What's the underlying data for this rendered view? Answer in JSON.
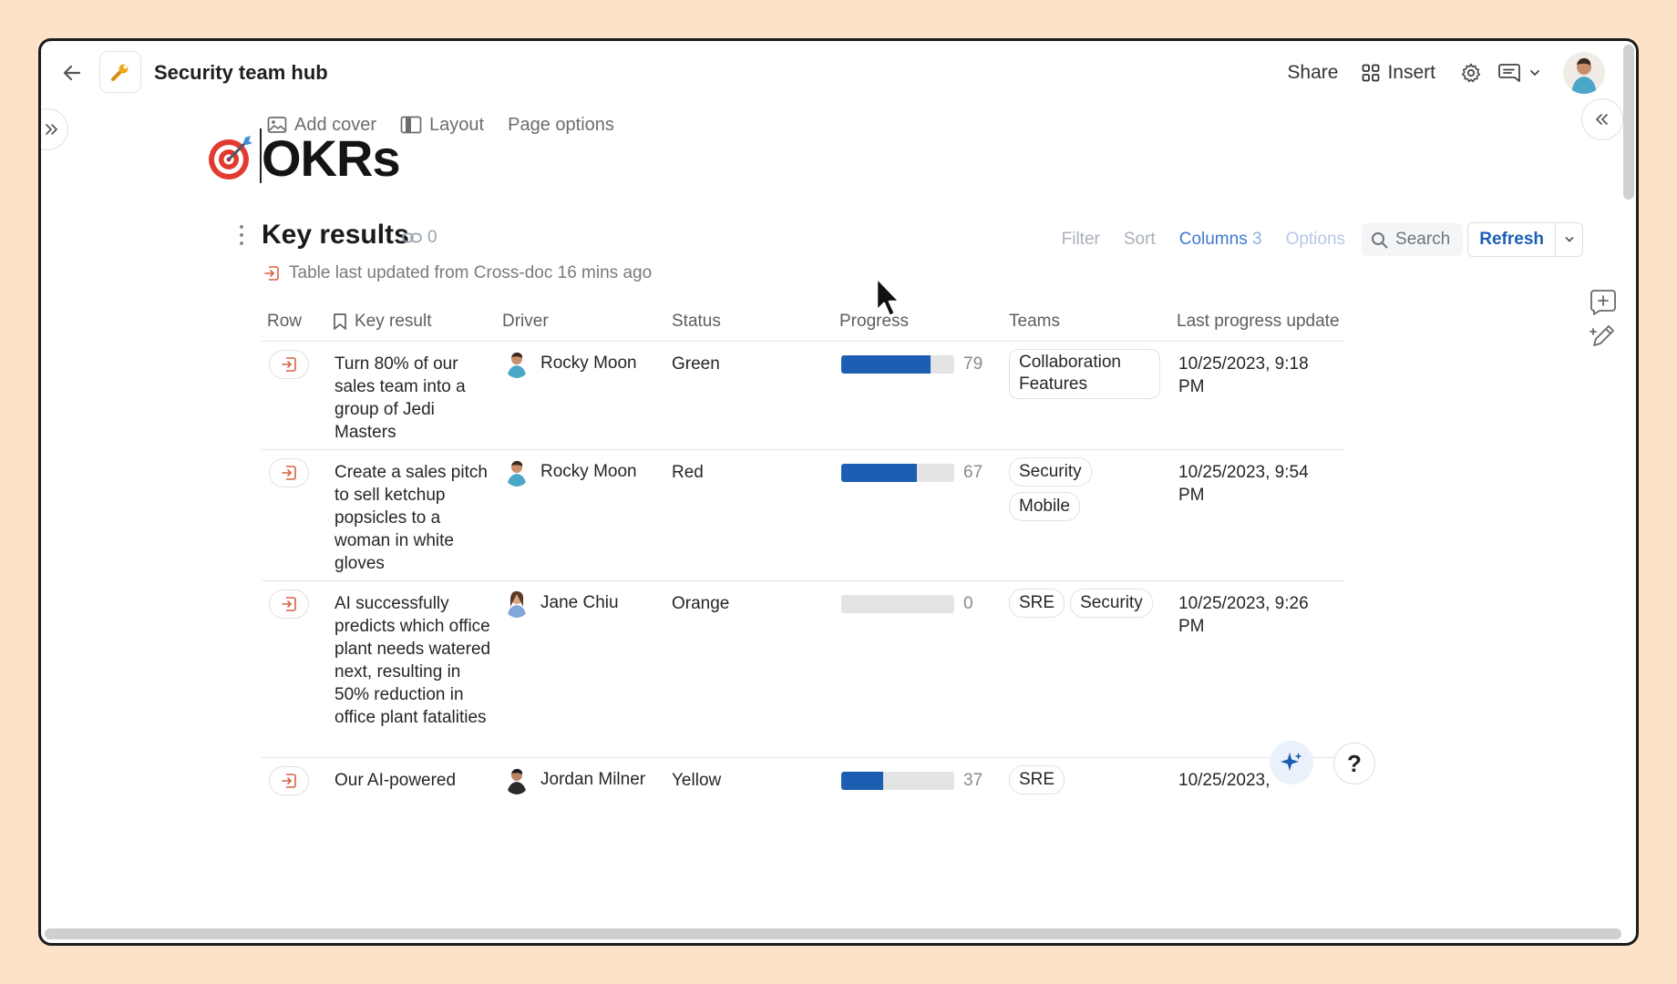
{
  "topbar": {
    "doc_title": "Security team hub",
    "share_label": "Share",
    "insert_label": "Insert"
  },
  "page_options": {
    "add_cover": "Add cover",
    "layout": "Layout",
    "page_options": "Page options"
  },
  "page": {
    "title": "OKRs"
  },
  "table_section": {
    "title": "Key results",
    "link_count": "0",
    "update_note": "Table last updated from Cross-doc 16 mins ago",
    "toolbar": {
      "filter": "Filter",
      "sort": "Sort",
      "columns": "Columns",
      "columns_count": "3",
      "options": "Options",
      "search": "Search",
      "refresh": "Refresh"
    },
    "columns": [
      "Row",
      "Key result",
      "Driver",
      "Status",
      "Progress",
      "Teams",
      "Last progress update"
    ],
    "rows": [
      {
        "key_result": "Turn 80% of our sales team into a group of Jedi Masters",
        "driver": "Rocky Moon",
        "status": "Green",
        "progress": 79,
        "progress_label": "79",
        "teams": [
          "Collaboration Features"
        ],
        "last_update": "10/25/2023, 9:18 PM"
      },
      {
        "key_result": "Create a sales pitch to sell ketchup popsicles to a woman in white gloves",
        "driver": "Rocky Moon",
        "status": "Red",
        "progress": 67,
        "progress_label": "67",
        "teams": [
          "Security",
          "Mobile"
        ],
        "last_update": "10/25/2023, 9:54 PM"
      },
      {
        "key_result": "AI successfully predicts which office plant needs watered next, resulting in 50% reduction in office plant fatalities",
        "driver": "Jane Chiu",
        "status": "Orange",
        "progress": 0,
        "progress_label": "0",
        "teams": [
          "SRE",
          "Security"
        ],
        "last_update": "10/25/2023, 9:26 PM"
      },
      {
        "key_result": "Our AI-powered",
        "driver": "Jordan Milner",
        "status": "Yellow",
        "progress": 37,
        "progress_label": "37",
        "teams": [
          "SRE"
        ],
        "last_update": "10/25/2023,"
      }
    ]
  },
  "help": {
    "label": "?"
  },
  "colors": {
    "background": "#fce3c8",
    "accent": "#1c5fb2",
    "link": "#3f7ad0",
    "target_red": "#e23a2e"
  },
  "icons": [
    "back-arrow-icon",
    "wrench-icon",
    "insert-grid-icon",
    "gear-icon",
    "comment-icon",
    "chevron-down-icon",
    "image-icon",
    "layout-icon",
    "target-icon",
    "link-icon",
    "search-icon",
    "row-open-icon",
    "bookmark-icon",
    "add-comment-icon",
    "edit-icon",
    "sparkle-icon"
  ]
}
